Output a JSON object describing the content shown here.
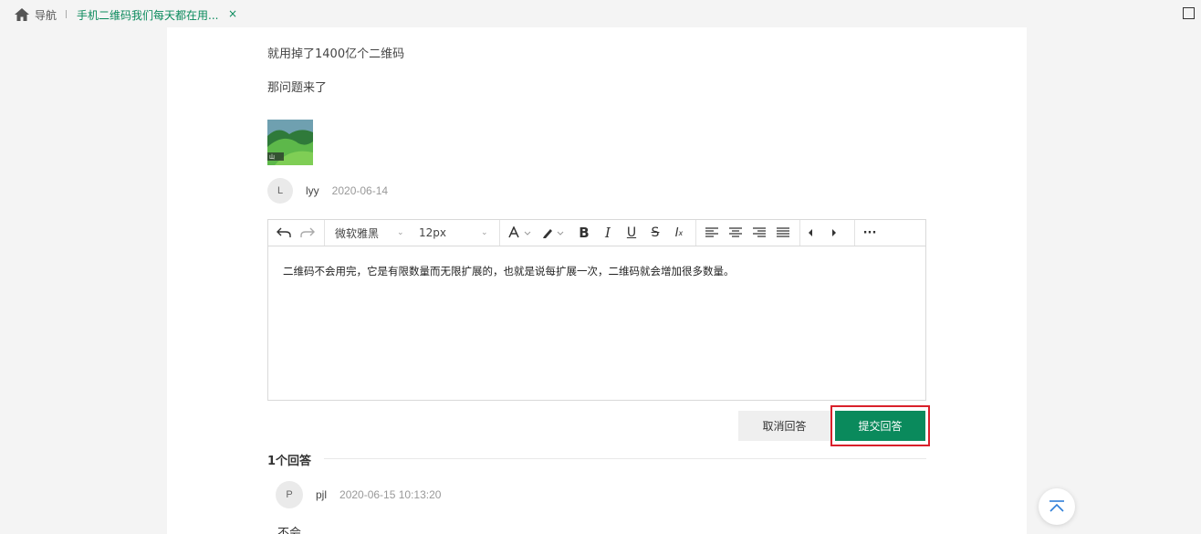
{
  "tabs": {
    "home_label": "导航",
    "active_label": "手机二维码我们每天都在用...",
    "close_glyph": "×"
  },
  "article": {
    "para1": "就用掉了1400亿个二维码",
    "para2": "那问题来了",
    "thumb_caption": "山"
  },
  "question_author": {
    "initial": "L",
    "name": "lyy",
    "date": "2020-06-14"
  },
  "editor": {
    "font_family": "微软雅黑",
    "font_size": "12px",
    "more": "···",
    "content": "二维码不会用完，它是有限数量而无限扩展的，也就是说每扩展一次，二维码就会增加很多数量。"
  },
  "actions": {
    "cancel_label": "取消回答",
    "submit_label": "提交回答"
  },
  "answers": {
    "count_label": "1个回答",
    "items": [
      {
        "initial": "P",
        "name": "pjl",
        "date": "2020-06-15 10:13:20",
        "text": "不会"
      }
    ]
  },
  "colors": {
    "accent": "#0a8a5c",
    "highlight": "#d9202a"
  }
}
